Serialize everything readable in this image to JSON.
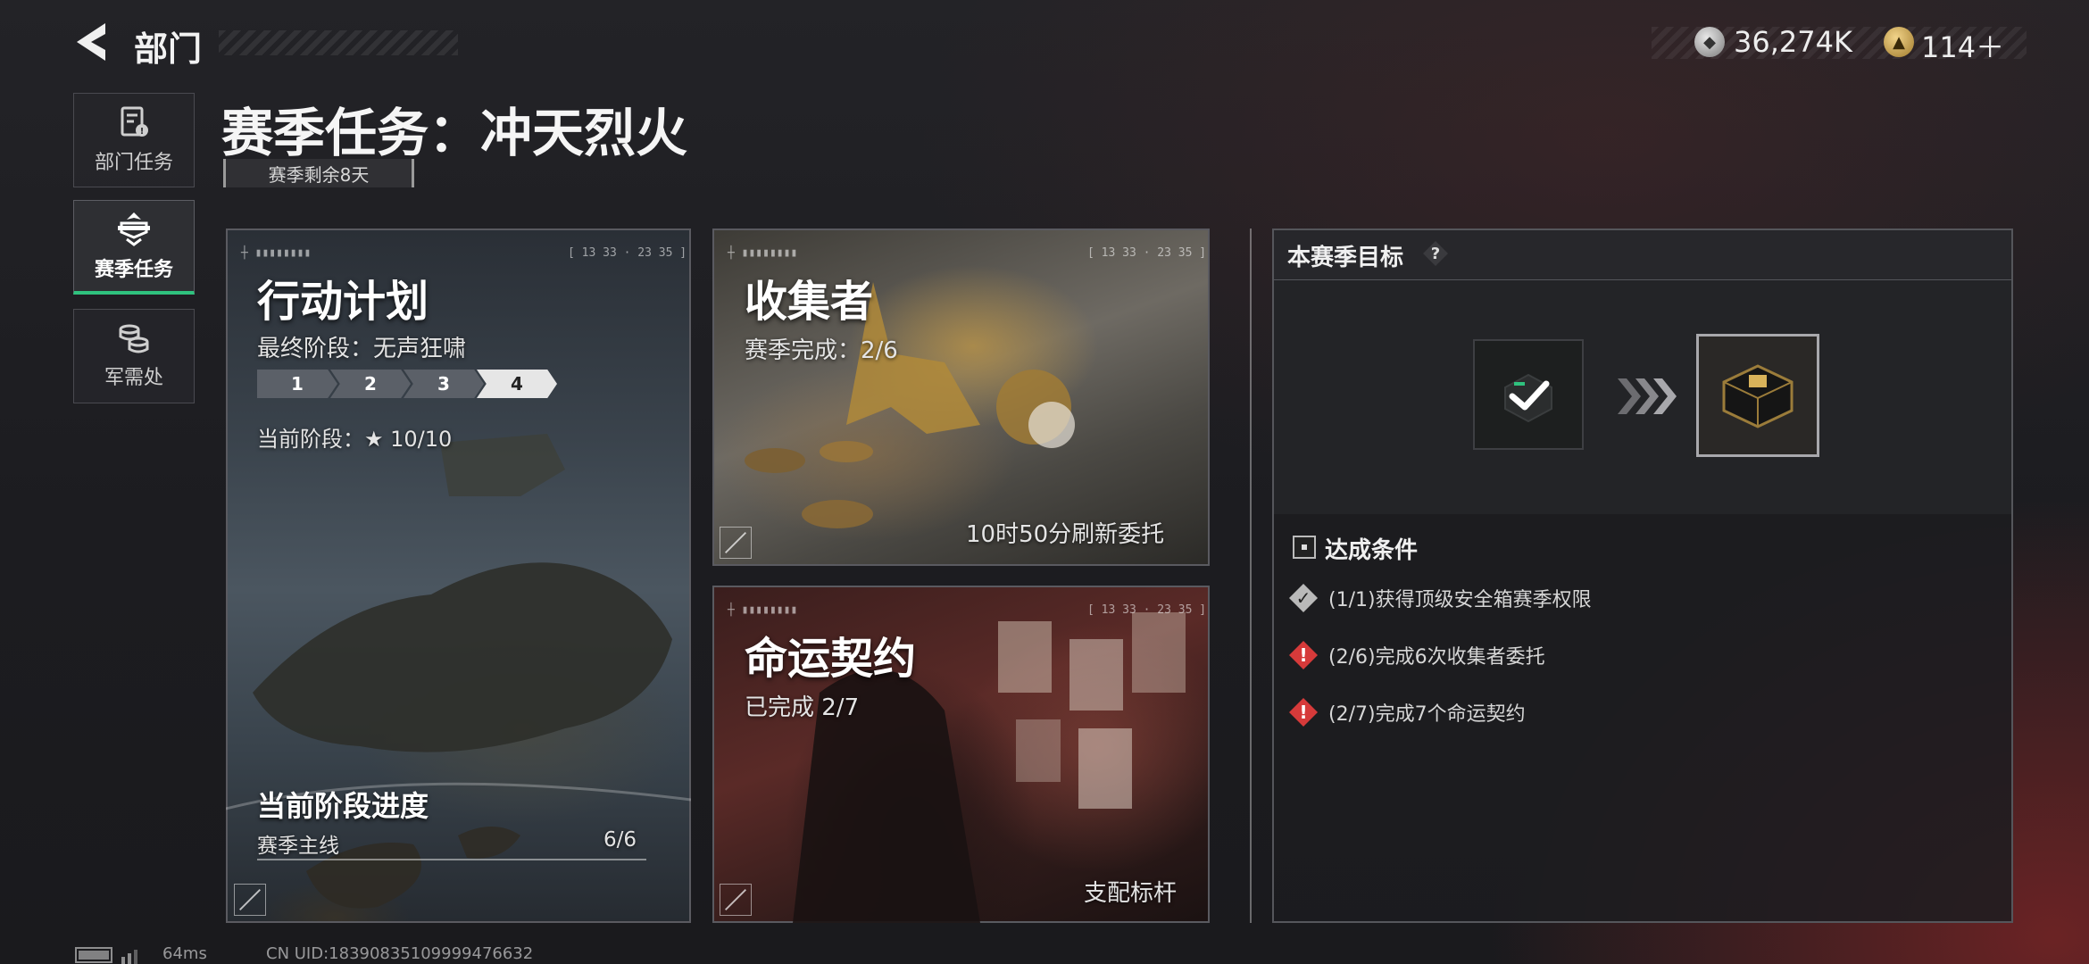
{
  "header": {
    "back_title": "部门",
    "currency": [
      {
        "icon": "silver-coin-icon",
        "value": "36,274K"
      },
      {
        "icon": "gold-coin-icon",
        "value": "114＋"
      }
    ]
  },
  "sidebar": {
    "items": [
      {
        "label": "部门任务",
        "icon": "task-document-icon",
        "active": false
      },
      {
        "label": "赛季任务",
        "icon": "season-emblem-icon",
        "active": true
      },
      {
        "label": "军需处",
        "icon": "coin-stack-icon",
        "active": false
      }
    ]
  },
  "page": {
    "title": "赛季任务：冲天烈火",
    "season_remaining": "赛季剩余8天"
  },
  "cards": {
    "plan": {
      "title": "行动计划",
      "final_stage": "最终阶段：无声狂啸",
      "stages": [
        "1",
        "2",
        "3",
        "4"
      ],
      "current_stage_index": 3,
      "current_stage": "当前阶段：★ 10/10",
      "progress_title": "当前阶段进度",
      "progress_label": "赛季主线",
      "progress_value": "6/6"
    },
    "collector": {
      "title": "收集者",
      "progress": "赛季完成：2/6",
      "refresh": "10时50分刷新委托"
    },
    "contract": {
      "title": "命运契约",
      "progress": "已完成 2/7",
      "footer": "支配标杆"
    },
    "hud_time": "[ 13 33 · 23 35 ]"
  },
  "objectives": {
    "title": "本赛季目标",
    "help": "?",
    "conditions_title": "达成条件",
    "conditions": [
      {
        "text": "(1/1)获得顶级安全箱赛季权限",
        "status": "done"
      },
      {
        "text": "(2/6)完成6次收集者委托",
        "status": "incomplete"
      },
      {
        "text": "(2/7)完成7个命运契约",
        "status": "incomplete"
      }
    ]
  },
  "footer": {
    "ping": "64ms",
    "uid": "CN UID:18390835109999476632"
  },
  "colors": {
    "accent_green": "#2fc27e",
    "warning_red": "#d63a3a"
  }
}
